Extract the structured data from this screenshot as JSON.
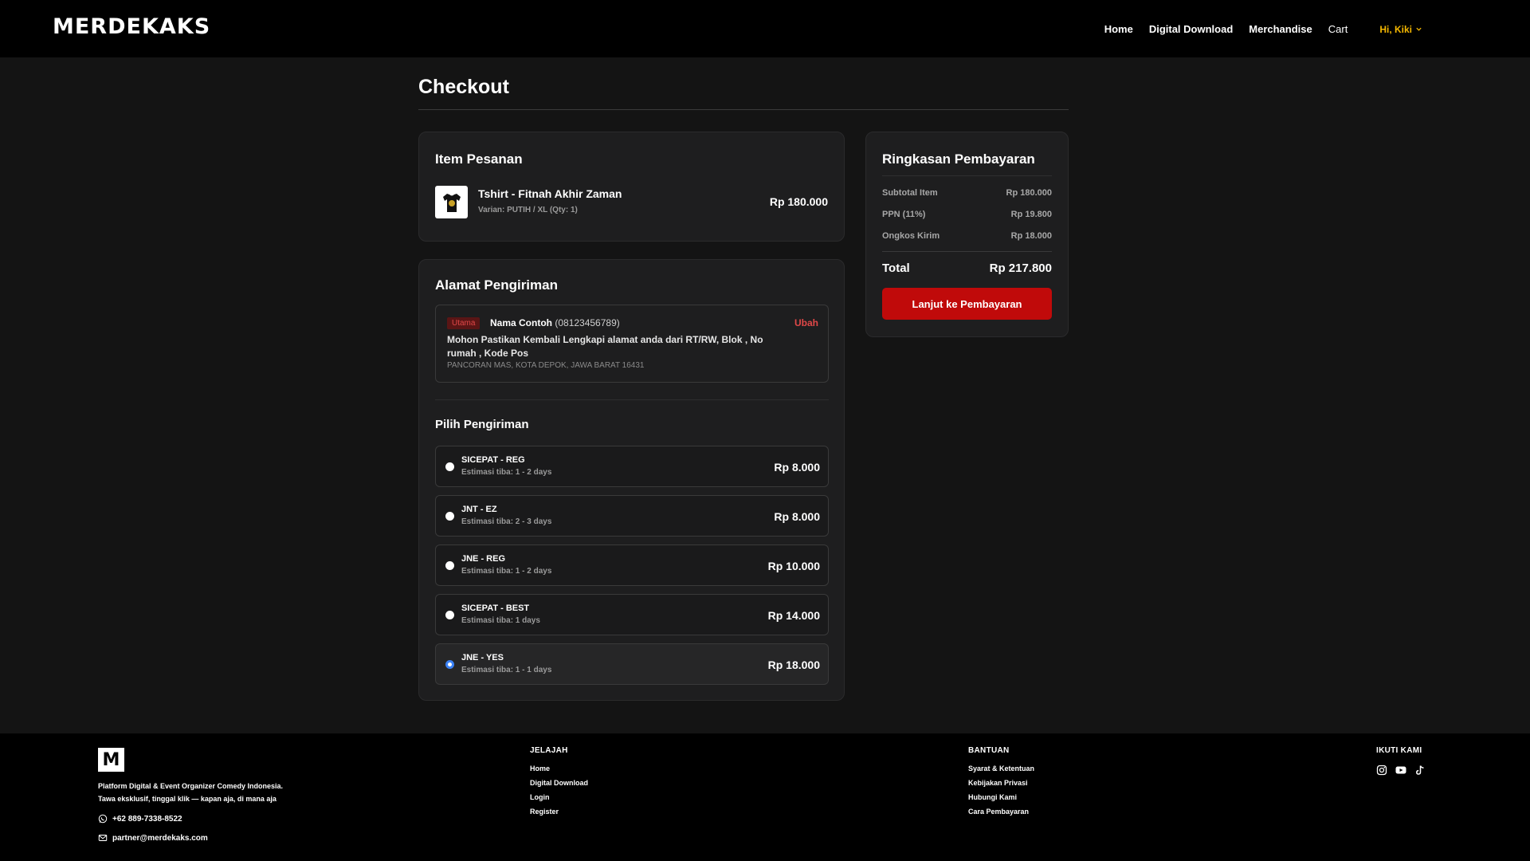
{
  "header": {
    "logo_text": "MERDEKAKS",
    "nav": [
      "Home",
      "Digital Download",
      "Merchandise",
      "Cart"
    ],
    "user_greeting": "Hi, Kiki",
    "accent_color": "#f5b800"
  },
  "page": {
    "title": "Checkout"
  },
  "items": {
    "title": "Item Pesanan",
    "list": [
      {
        "name": "Tshirt - Fitnah Akhir Zaman",
        "variant": "Varian: PUTIH / XL (Qty: 1)",
        "price": "Rp 180.000"
      }
    ]
  },
  "address": {
    "title": "Alamat Pengiriman",
    "badge": "Utama",
    "name": "Nama Contoh",
    "phone": "(08123456789)",
    "edit_label": "Ubah",
    "line": "Mohon Pastikan Kembali Lengkapi alamat anda dari RT/RW, Blok , No rumah , Kode Pos",
    "region": "PANCORAN MAS, KOTA DEPOK, JAWA BARAT 16431"
  },
  "shipping": {
    "title": "Pilih Pengiriman",
    "options": [
      {
        "name": "SICEPAT - REG",
        "eta": "Estimasi tiba: 1 - 2 days",
        "price": "Rp 8.000",
        "selected": false
      },
      {
        "name": "JNT - EZ",
        "eta": "Estimasi tiba: 2 - 3 days",
        "price": "Rp 8.000",
        "selected": false
      },
      {
        "name": "JNE - REG",
        "eta": "Estimasi tiba: 1 - 2 days",
        "price": "Rp 10.000",
        "selected": false
      },
      {
        "name": "SICEPAT - BEST",
        "eta": "Estimasi tiba: 1 days",
        "price": "Rp 14.000",
        "selected": false
      },
      {
        "name": "JNE - YES",
        "eta": "Estimasi tiba: 1 - 1 days",
        "price": "Rp 18.000",
        "selected": true
      }
    ]
  },
  "summary": {
    "title": "Ringkasan Pembayaran",
    "rows": [
      {
        "label": "Subtotal Item",
        "value": "Rp 180.000"
      },
      {
        "label": "PPN (11%)",
        "value": "Rp 19.800"
      },
      {
        "label": "Ongkos Kirim",
        "value": "Rp 18.000"
      }
    ],
    "total_label": "Total",
    "total_value": "Rp 217.800",
    "pay_button": "Lanjut ke Pembayaran",
    "button_color": "#c00a0a"
  },
  "footer": {
    "logo_letter": "M",
    "desc_line1": "Platform Digital & Event Organizer Comedy Indonesia.",
    "desc_line2": "Tawa eksklusif, tinggal klik — kapan aja, di mana aja",
    "phone": "+62 889-7338-8522",
    "email": "partner@merdekaks.com",
    "explore_title": "JELAJAH",
    "explore_links": [
      "Home",
      "Digital Download",
      "Login",
      "Register"
    ],
    "help_title": "BANTUAN",
    "help_links": [
      "Syarat & Ketentuan",
      "Kebijakan Privasi",
      "Hubungi Kami",
      "Cara Pembayaran"
    ],
    "follow_title": "IKUTI KAMI",
    "social_icons": [
      "instagram-icon",
      "youtube-icon",
      "tiktok-icon"
    ]
  }
}
